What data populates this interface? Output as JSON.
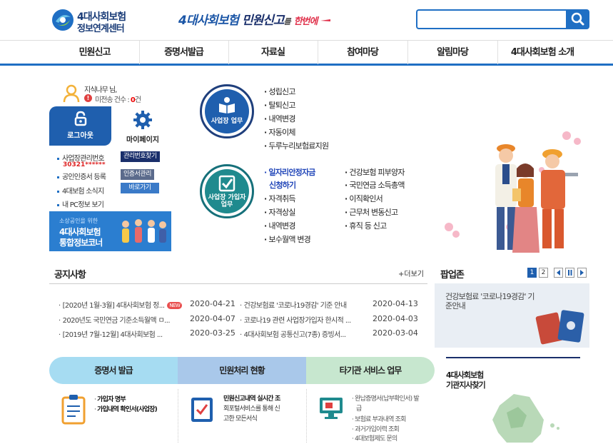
{
  "header": {
    "logo_line1": "4대사회보험",
    "logo_line2": "정보연계센터",
    "slogan_part1": "4대사회보험",
    "slogan_part2": "민원신고",
    "slogan_part3": "를",
    "slogan_part4": "한번에",
    "search_placeholder": ""
  },
  "nav": {
    "items": [
      {
        "label": "민원신고"
      },
      {
        "label": "증명서발급"
      },
      {
        "label": "자료실"
      },
      {
        "label": "참여마당"
      },
      {
        "label": "알림마당"
      },
      {
        "label": "4대사회보험 소개"
      }
    ]
  },
  "user": {
    "name": "지식나무 님,",
    "unsent_label": "미전송 건수 :",
    "unsent_count": "0",
    "unsent_unit": "건",
    "logout_label": "로그아웃",
    "mypage_label": "마이페이지"
  },
  "side_links": [
    {
      "label": "사업장관리번호",
      "button": "관리번호찾기",
      "value": "30321******"
    },
    {
      "label": "공인인증서 등록",
      "button": "인증서관리"
    },
    {
      "label": "4대보험 소식지",
      "button": "바로가기"
    },
    {
      "label": "내 PC정보 보기"
    }
  ],
  "banner": {
    "line1": "소상공인을 위한",
    "line2": "4대사회보험",
    "line3": "통합정보코너"
  },
  "workplace": {
    "title": "사업장 업무",
    "items": [
      "성립신고",
      "탈퇴신고",
      "내역변경",
      "자동이체",
      "두루누리보험료지원"
    ]
  },
  "subscriber": {
    "title_line1": "사업장 가입자",
    "title_line2": "업무",
    "col1": [
      "일자리안정자금",
      "신청하기",
      "자격취득",
      "자격상실",
      "내역변경",
      "보수월액 변경"
    ],
    "col2": [
      "건강보험 피부양자",
      "국민연금 소득총액",
      "이직확인서",
      "근무처 변동신고",
      "휴직 등 신고"
    ]
  },
  "notice": {
    "title": "공지사항",
    "more": "+더보기",
    "new_badge": "NEW",
    "items": [
      {
        "text": "[2020년 1월-3월] 4대사회보험 정...",
        "date": "2020-04-21",
        "is_new": true
      },
      {
        "text": "건강보험료 '코로나19경감' 기준 안내",
        "date": "2020-04-13"
      },
      {
        "text": "2020년도 국민연금 기준소득월액 ㅁ...",
        "date": "2020-04-07"
      },
      {
        "text": "코로나19 관련 사업장가입자 한시적 ...",
        "date": "2020-04-03"
      },
      {
        "text": "[2019년 7월-12월] 4대사회보험 ...",
        "date": "2020-03-25"
      },
      {
        "text": "4대사회보험 공통신고(7종) 증빙서...",
        "date": "2020-03-04"
      }
    ]
  },
  "popup": {
    "title": "팝업존",
    "page1": "1",
    "page2": "2",
    "text_line1": "건강보험료 '코로나19경감' 기",
    "text_line2": "준안내"
  },
  "bottom_tabs": [
    {
      "label": "증명서 발급"
    },
    {
      "label": "민원처리 현황"
    },
    {
      "label": "타기관 서비스 업무"
    }
  ],
  "cert": {
    "items": [
      "가입자 명부",
      "가입내역 확인서(사업장)"
    ]
  },
  "status": {
    "line1": "민원신고내역 실시간 조",
    "line2": "회포털서비스를 통해 신",
    "line3": "고한 모든서식"
  },
  "other": {
    "items": [
      "완납증명서(납부확인서) 발",
      "급",
      "보험료 부과내역 조회",
      "과거가입이력 조회",
      "4대보험제도 문의"
    ]
  },
  "region": {
    "line1": "4대사회보험",
    "line2": "기관지사찾기"
  },
  "colors": {
    "primary": "#1f5fae",
    "accent_red": "#e04040",
    "tab1": "#9fd8ef",
    "tab2": "#a9c9e9",
    "tab3": "#c4e5cc"
  }
}
